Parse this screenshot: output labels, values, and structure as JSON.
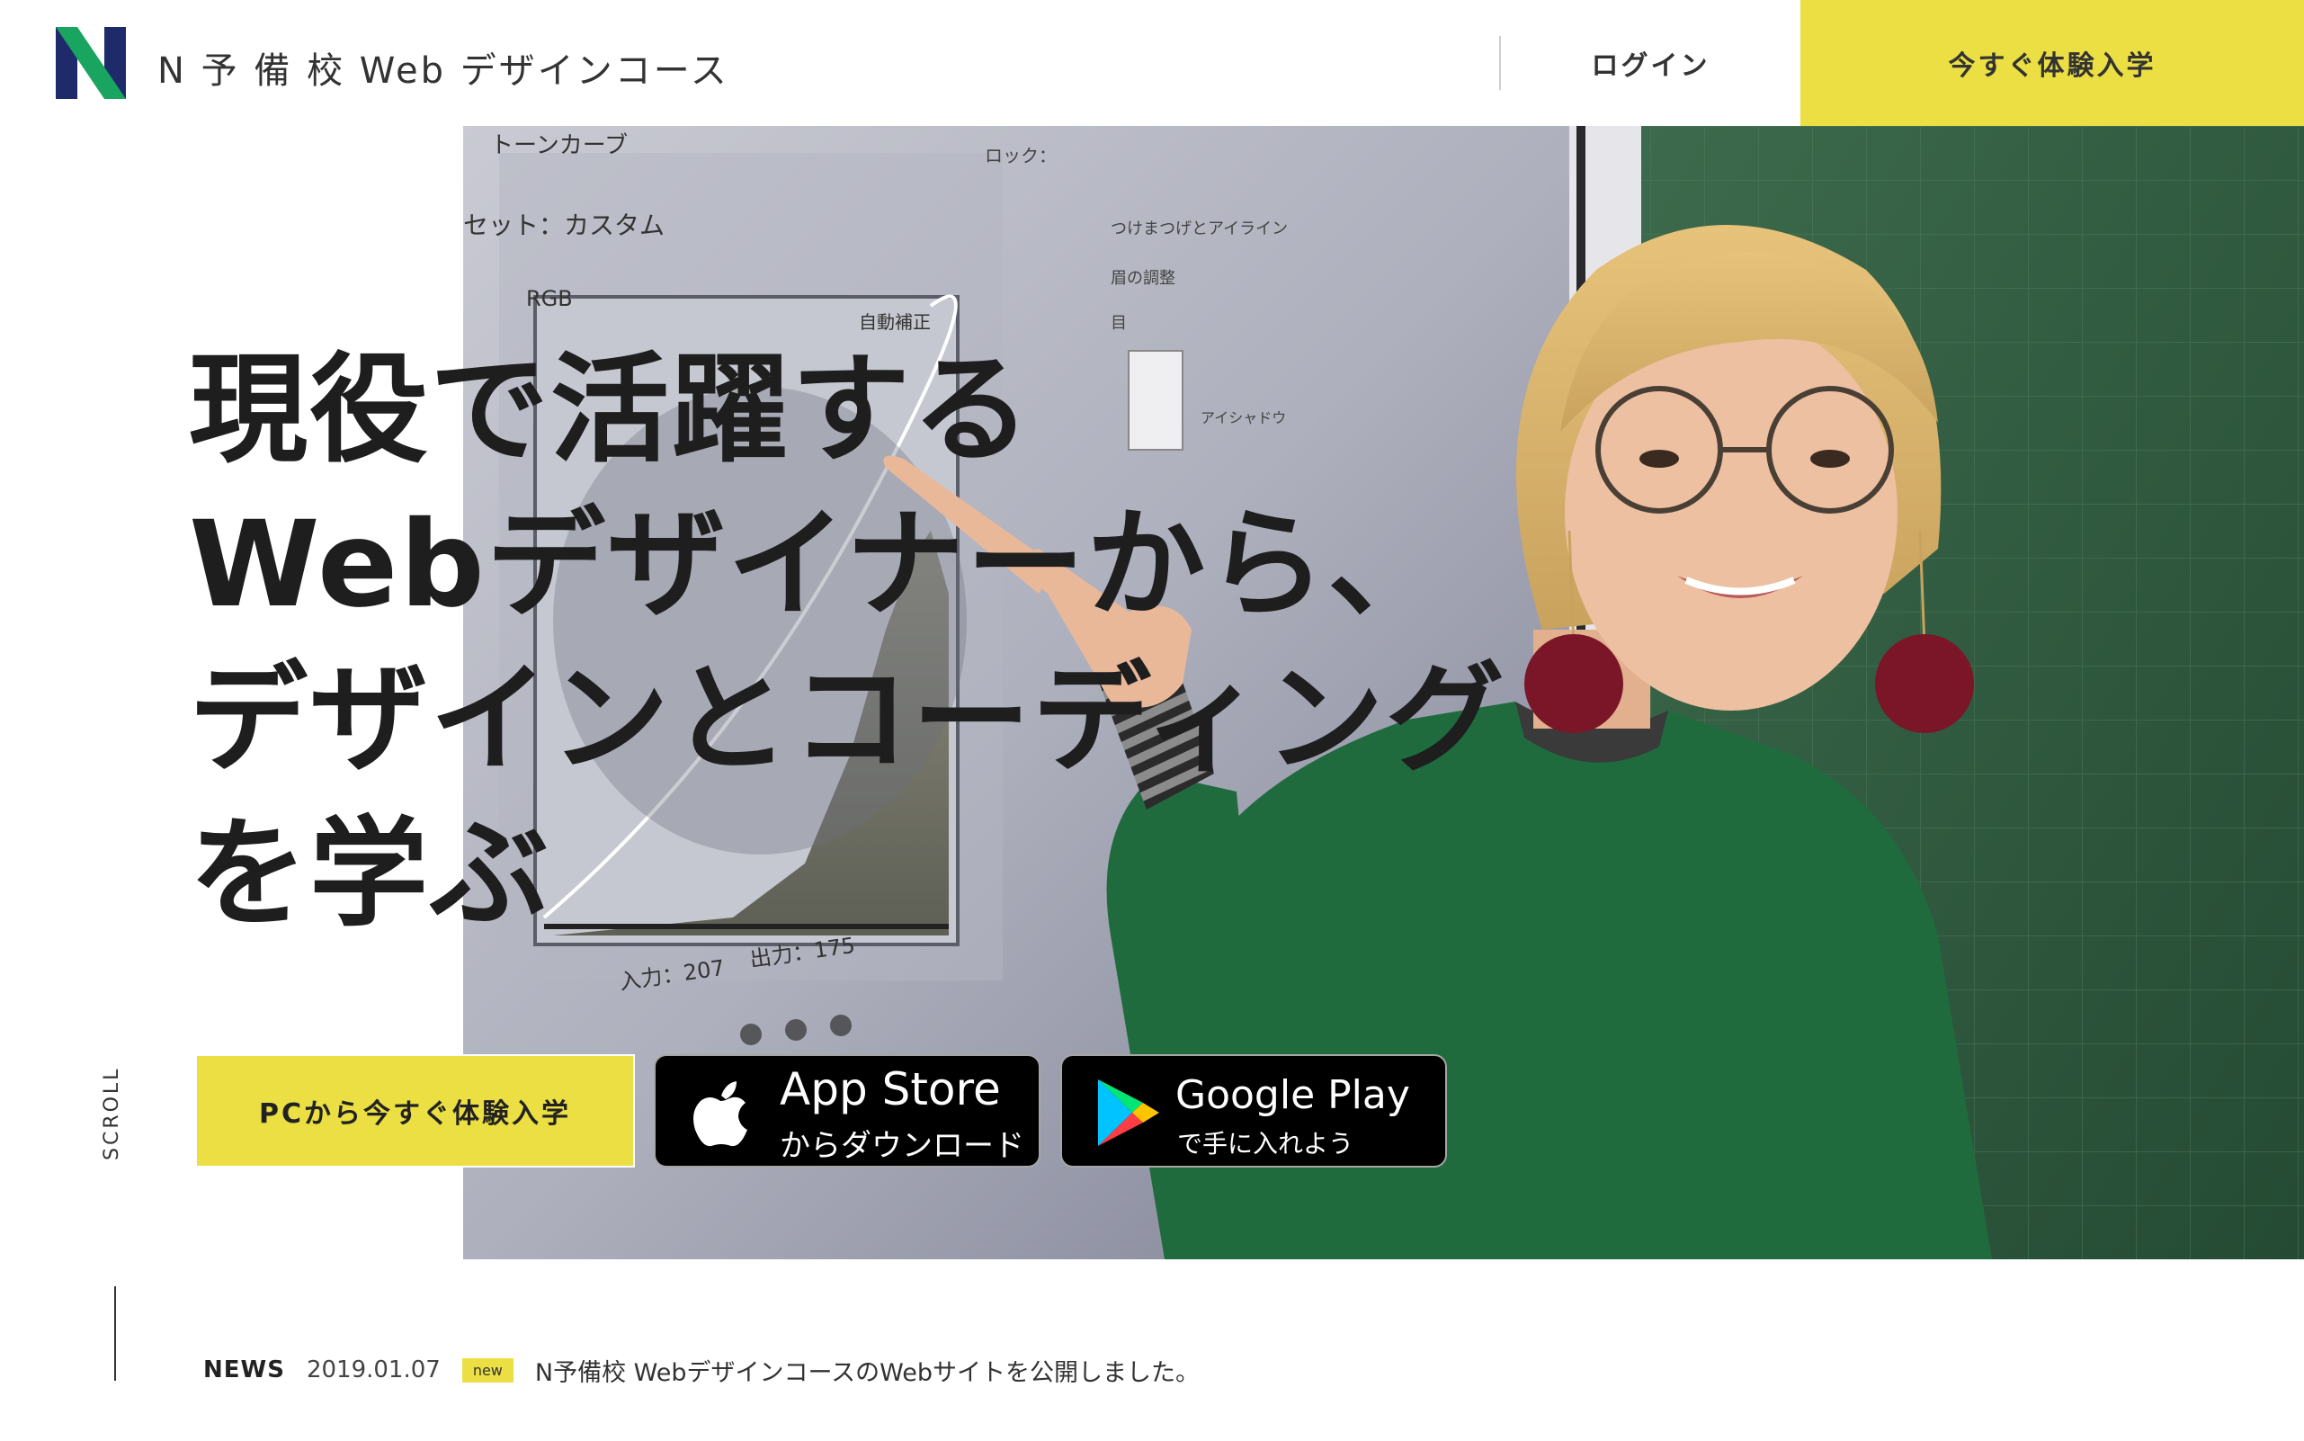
{
  "header": {
    "logo_text": "N 予 備 校  Web デザインコース",
    "login_label": "ログイン",
    "trial_label": "今すぐ体験入学"
  },
  "hero": {
    "headline_lines": [
      "現役で活躍する",
      "Webデザイナーから、",
      "デザインとコーディング",
      "を学ぶ"
    ],
    "pc_trial_label": "PCから今すぐ体験入学",
    "app_store": {
      "main": "App Store",
      "sub": "からダウンロード"
    },
    "google_play": {
      "main": "Google Play",
      "sub": "で手に入れよう"
    }
  },
  "screen_text": {
    "panel_title": "トーンカーブ",
    "preset": "セット：カスタム",
    "channel": "RGB",
    "auto": "自動補正",
    "lock": "ロック：",
    "input": "入力：207",
    "output": "出力：175",
    "layer1": "つけまつげとアイライン",
    "layer2": "眉の調整",
    "layer3": "目",
    "layer4": "アイシャドウ"
  },
  "scroll": {
    "label": "SCROLL"
  },
  "news": {
    "heading": "NEWS",
    "date": "2019.01.07",
    "badge": "new",
    "text": "N予備校 WebデザインコースのWebサイトを公開しました。"
  },
  "colors": {
    "accent_yellow": "#ebdf44",
    "logo_navy": "#1f2a6b",
    "logo_green": "#19a45f",
    "sweater_green": "#1f6b3e",
    "board_green": "#2d5a3d"
  },
  "icons": [
    "n-logo-icon",
    "apple-icon",
    "google-play-icon"
  ]
}
